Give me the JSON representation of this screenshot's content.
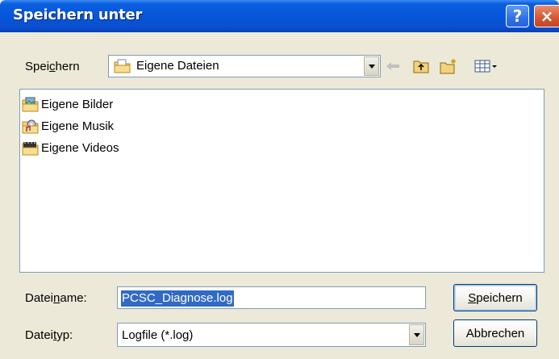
{
  "window": {
    "title": "Speichern unter",
    "help_glyph": "?",
    "close_glyph": "×"
  },
  "save_in": {
    "label_before": "Spei",
    "label_mnemonic": "c",
    "label_after": "hern",
    "value": "Eigene Dateien"
  },
  "toolbar": {
    "back_icon": "back-arrow-icon",
    "up_icon": "up-folder-icon",
    "new_folder_icon": "new-folder-icon",
    "views_icon": "views-menu-icon"
  },
  "files": [
    {
      "name": "Eigene Bilder",
      "icon": "pictures-folder-icon"
    },
    {
      "name": "Eigene Musik",
      "icon": "music-folder-icon"
    },
    {
      "name": "Eigene Videos",
      "icon": "videos-folder-icon"
    }
  ],
  "filename": {
    "label_before": "Datei",
    "label_mnemonic": "n",
    "label_after": "ame:",
    "value": "PCSC_Diagnose.log"
  },
  "filetype": {
    "label_before": "Datei",
    "label_mnemonic": "t",
    "label_after": "yp:",
    "value": "Logfile (*.log)"
  },
  "buttons": {
    "save_mnemonic": "S",
    "save_rest": "peichern",
    "cancel": "Abbrechen"
  },
  "colors": {
    "titlebar": "#0655D8",
    "selection": "#316AC5",
    "dialog_bg": "#ECE9D8"
  }
}
